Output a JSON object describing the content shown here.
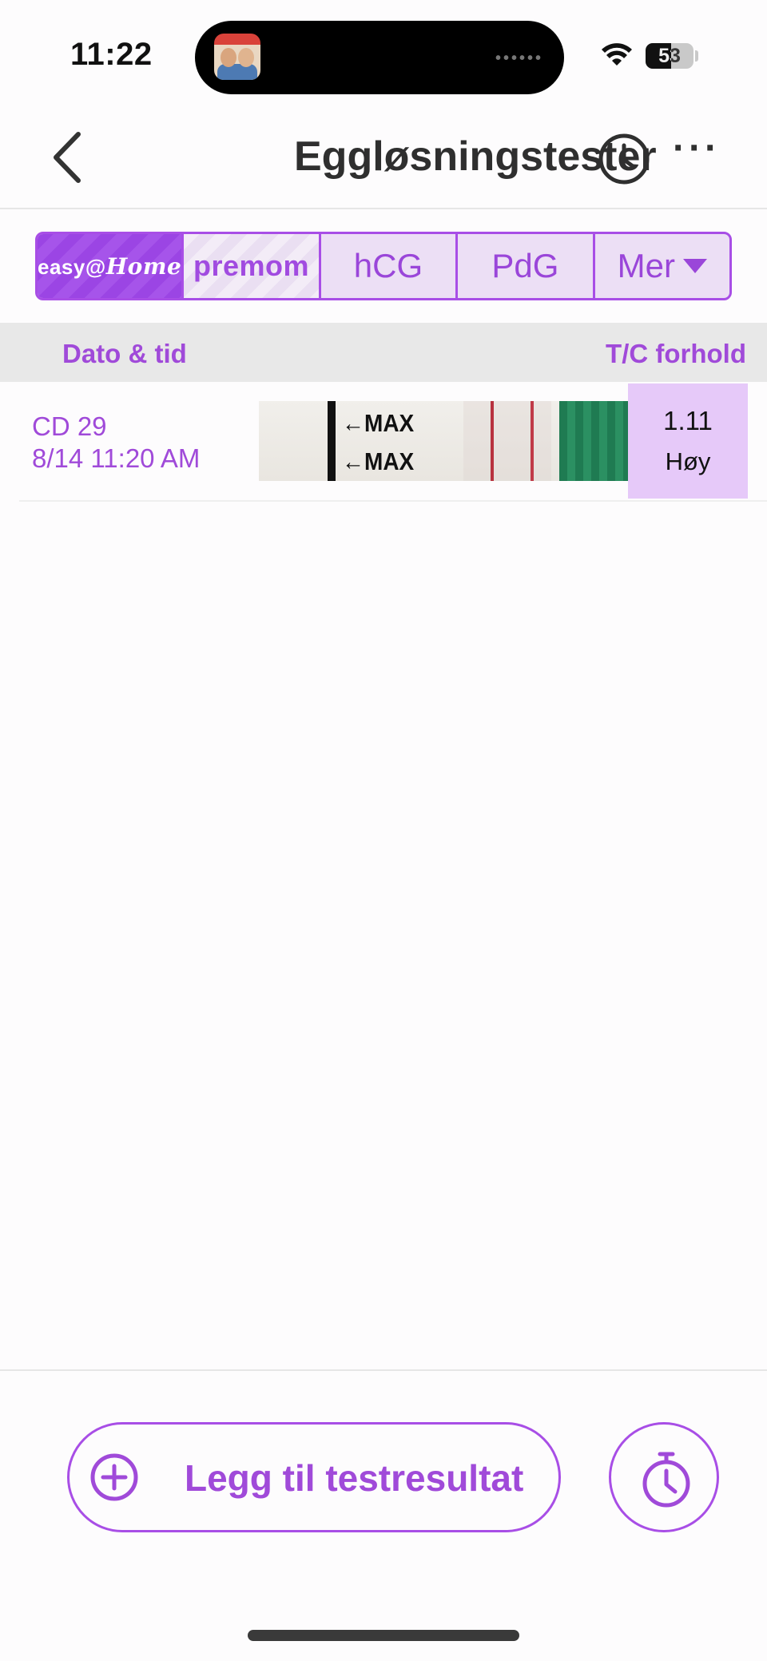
{
  "status_bar": {
    "time": "11:22",
    "battery": "53",
    "battery_level_percent": 53
  },
  "nav": {
    "title": "Eggløsningstester"
  },
  "tabs": [
    {
      "label": "easy@Home",
      "brand": "easy",
      "logo_a": "easy",
      "logo_b": "@",
      "logo_c": "Home"
    },
    {
      "label": "premom"
    },
    {
      "label": "hCG"
    },
    {
      "label": "PdG"
    },
    {
      "label": "Mer"
    }
  ],
  "table": {
    "headers": {
      "date": "Dato & tid",
      "ratio": "T/C forhold"
    },
    "rows": [
      {
        "cycle_day": "CD 29",
        "datetime": "8/14 11:20 AM",
        "strip_marks": [
          "←MAX",
          "←MAX"
        ],
        "ratio": "1.11",
        "level": "Høy"
      }
    ]
  },
  "actions": {
    "add_result": "Legg til testresultat"
  },
  "colors": {
    "accent": "#a84ee6",
    "text_accent": "#a04ad9",
    "ratio_bg": "#e6c9f9"
  },
  "icons": [
    "back-icon",
    "timer-icon",
    "more-icon",
    "plus-circle-icon",
    "stopwatch-icon",
    "wifi-icon",
    "battery-icon"
  ]
}
